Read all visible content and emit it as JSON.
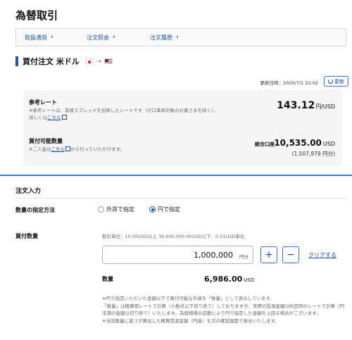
{
  "page": {
    "title": "為替取引"
  },
  "steps": [
    {
      "label": "取扱通貨"
    },
    {
      "label": "注文照会"
    },
    {
      "label": "注文履歴"
    }
  ],
  "section": {
    "title": "買付注文 米ドル",
    "arrow": "→"
  },
  "update": {
    "text": "更新日時：2025/7/1 22:02",
    "button_label": "更新"
  },
  "rate": {
    "label": "参考レート",
    "note_line1": "※参考レートは、為替スプレッドを加味したレートです（ゼロ革命対象のお客さまを除く）。",
    "note_line2_prefix": "詳しくは",
    "note_link": "こちら",
    "value": "143.12",
    "unit": "円/USD"
  },
  "buying_power": {
    "label": "買付可能数量",
    "note_prefix": "※ご入金は",
    "note_link": "こちら",
    "note_suffix": "から行っていただけます。",
    "account_label": "総合口座",
    "value": "10,535.00",
    "unit": "USD",
    "sub": "(1,507,979 円分)"
  },
  "order": {
    "title": "注文入力",
    "qty_method_label": "数量の指定方法",
    "options": [
      {
        "label": "外貨で指定",
        "selected": false
      },
      {
        "label": "円で指定",
        "selected": true
      }
    ],
    "buy_qty_label": "買付数量",
    "unit_note": "取引単位：10.00USD以上 30,000,000.00USD以下、0.01USD単位",
    "input_value": "1,000,000",
    "input_unit": "円分",
    "plus": "+",
    "minus": "−",
    "clear_label": "クリアする",
    "qty_label": "数量",
    "qty_value": "6,986.00",
    "qty_unit": "USD",
    "notes": [
      "※円で指定いただいた金額以下で買付可能な外貨を「数量」として表示しています。",
      "「数量」は概算用レートで計算（小数点以下切り捨て）しておりますが、実際の受渡金額は約定時のレートで計算（円未満の金額は切り捨て）いたします。為替相場の変動により円で指定した金額を上回る場合がございます。",
      "※当該数量に基づき算出した概算受渡金額（円貨）を次の確認画面で表示いたします。"
    ]
  },
  "colors": {
    "accent": "#1a56c4",
    "link": "#1a4d99",
    "divider": "#3e7ad6"
  }
}
